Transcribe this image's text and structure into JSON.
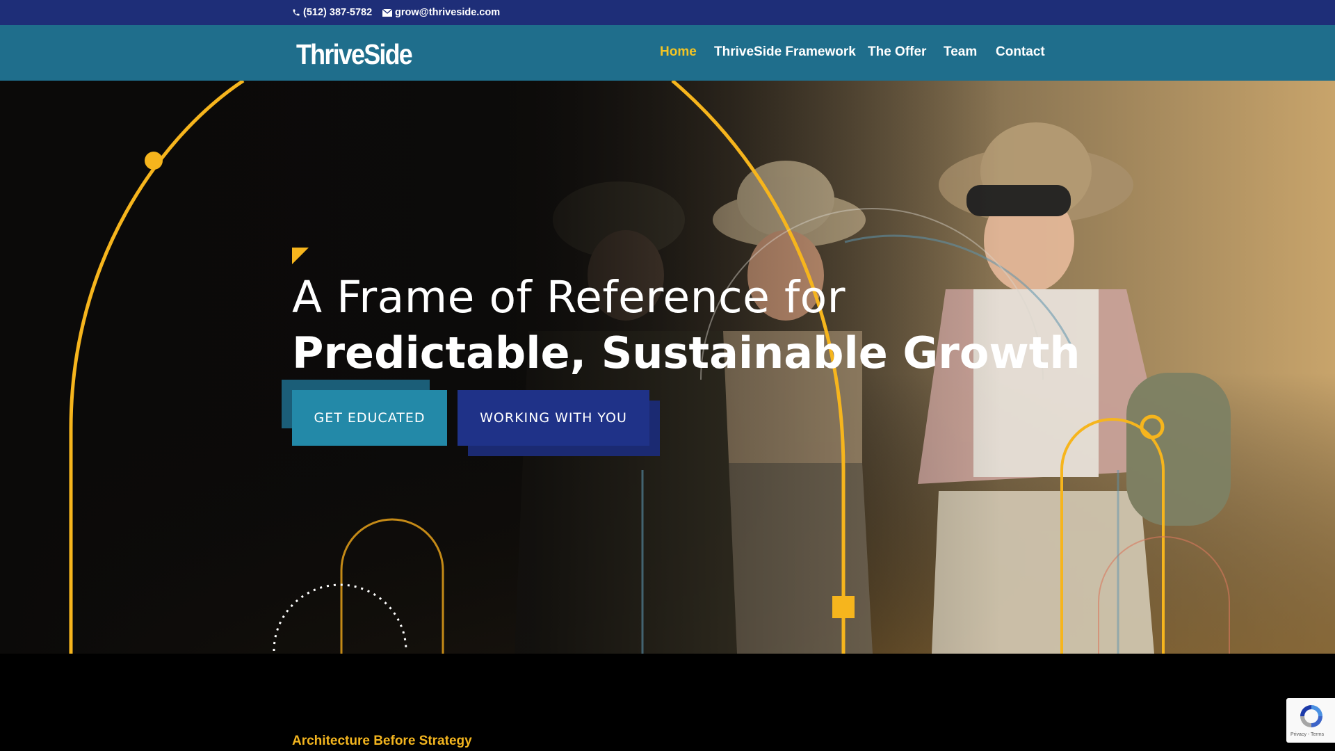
{
  "topbar": {
    "phone": "(512) 387-5782",
    "email": "grow@thriveside.com",
    "phone_icon": "phone-icon",
    "email_icon": "envelope-icon"
  },
  "header": {
    "logo_text": "ThriveSide",
    "nav": [
      {
        "label": "Home",
        "active": true
      },
      {
        "label": "ThriveSide Framework",
        "active": false
      },
      {
        "label": "The Offer",
        "active": false
      },
      {
        "label": "Team",
        "active": false
      },
      {
        "label": "Contact",
        "active": false
      }
    ]
  },
  "hero": {
    "title_line1": "A Frame of Reference for",
    "title_line2": "Predictable, Sustainable Growth",
    "buttons": {
      "primary": "GET EDUCATED",
      "secondary": "WORKING WITH YOU"
    }
  },
  "section2": {
    "eyebrow": "Architecture Before Strategy"
  },
  "recaptcha": {
    "links": "Privacy - Terms"
  },
  "colors": {
    "topbar": "#1e2e78",
    "header": "#1f6e8c",
    "accent_yellow": "#f3c424",
    "button_teal": "#2389a8",
    "button_navy": "#1f3288"
  }
}
